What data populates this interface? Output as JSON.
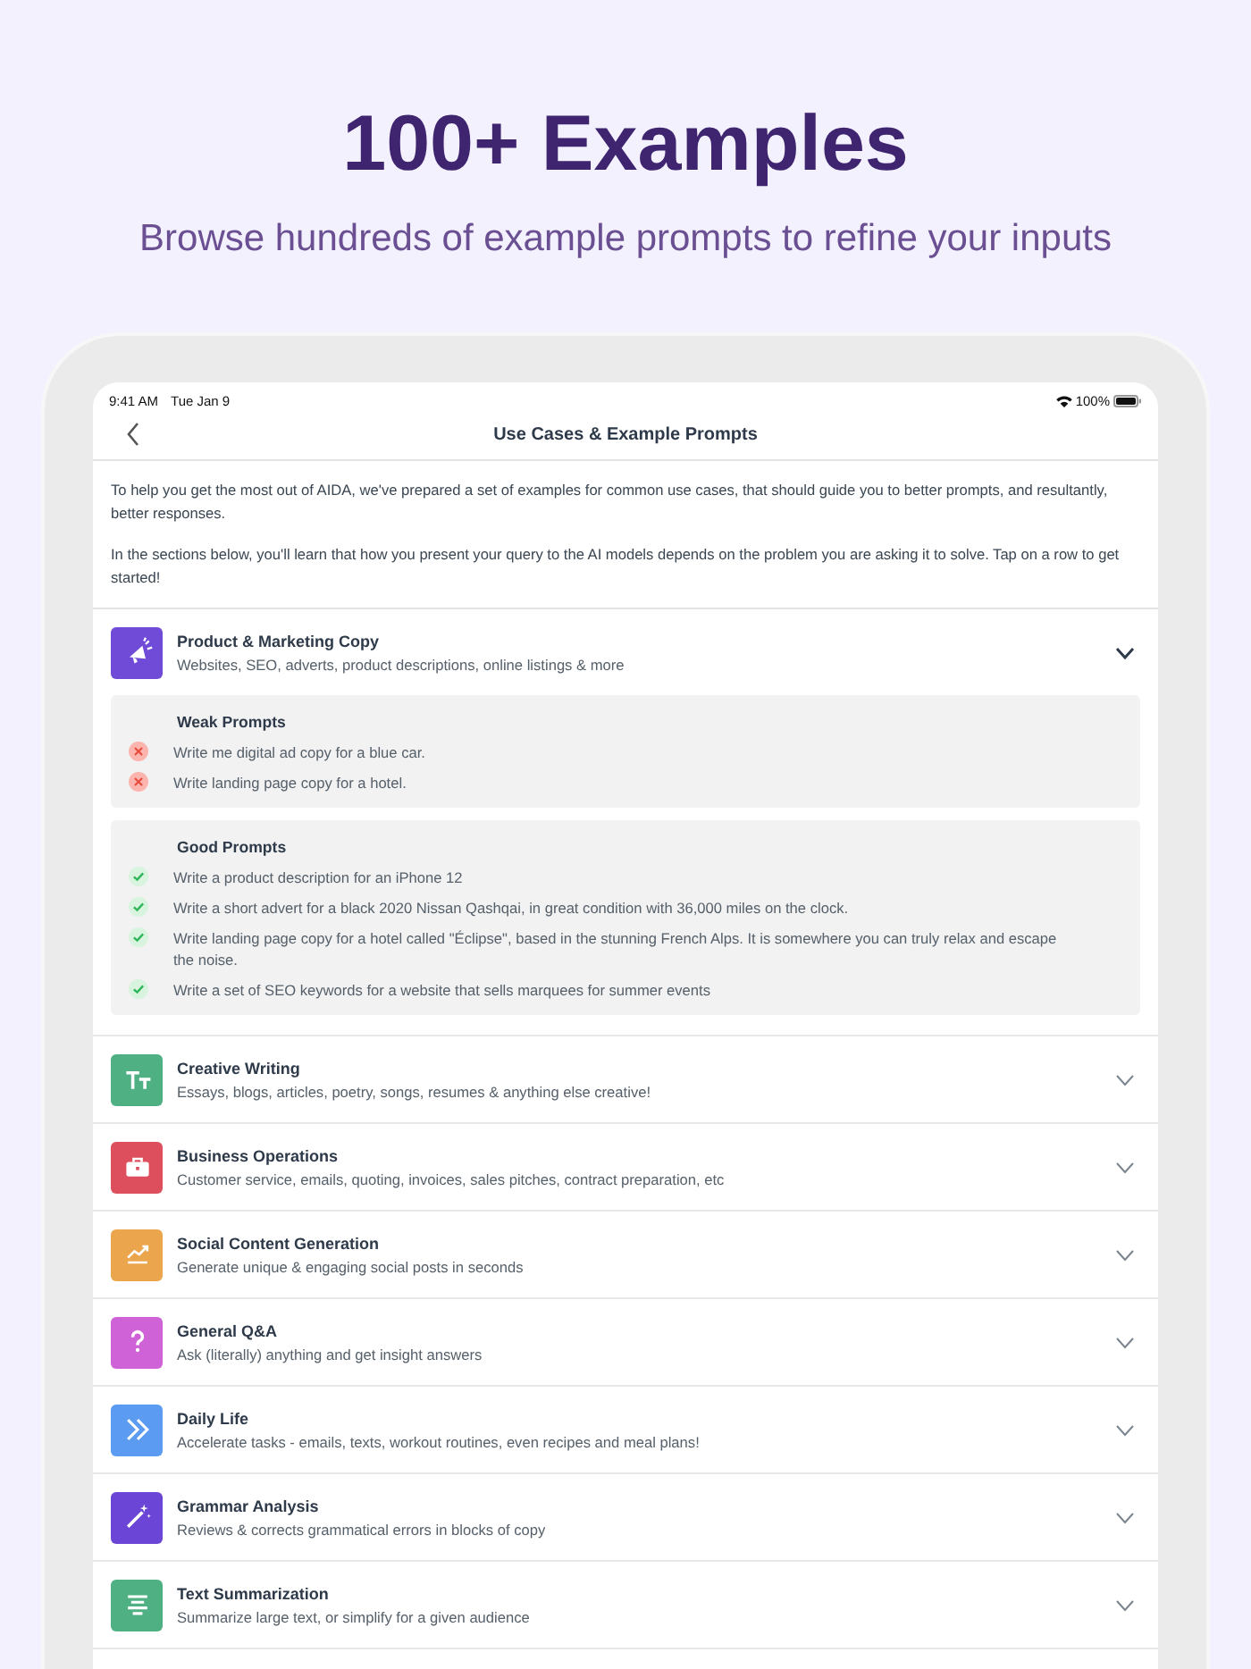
{
  "headline": "100+ Examples",
  "subheadline": "Browse hundreds of example prompts to refine your inputs",
  "status_bar": {
    "time": "9:41 AM",
    "date": "Tue Jan 9",
    "battery": "100%"
  },
  "nav": {
    "title": "Use Cases & Example Prompts"
  },
  "intro": [
    "To help you get the most out of AIDA, we've prepared a set of examples for common use cases, that should guide you to better prompts, and resultantly, better responses.",
    "In the sections below, you'll learn that how you present your query to the AI models depends on the problem you are asking it to solve. Tap on a row to get started!"
  ],
  "categories": [
    {
      "title": "Product & Marketing Copy",
      "subtitle": "Websites, SEO, adverts, product descriptions, online listings & more",
      "kind": "megaphone",
      "color": "#6f4bd8",
      "expanded": true,
      "groups": [
        {
          "kind": "weak",
          "title": "Weak Prompts",
          "items": [
            "Write me digital ad copy for a blue car.",
            "Write landing page copy for a hotel."
          ]
        },
        {
          "kind": "good",
          "title": "Good Prompts",
          "items": [
            "Write a product description for an iPhone 12",
            "Write a short advert for a black 2020 Nissan Qashqai, in great condition with 36,000 miles on the clock.",
            "Write landing page copy for a hotel called \"Éclipse\", based in the stunning French Alps. It is somewhere you can truly relax and escape the noise.",
            "Write a set of SEO keywords for a website that sells marquees for summer events"
          ]
        }
      ]
    },
    {
      "title": "Creative Writing",
      "subtitle": "Essays, blogs, articles, poetry, songs, resumes & anything else creative!",
      "kind": "text",
      "color": "#4fb183",
      "expanded": false
    },
    {
      "title": "Business Operations",
      "subtitle": "Customer service, emails, quoting, invoices, sales pitches, contract preparation, etc",
      "kind": "briefcase",
      "color": "#de4f5d",
      "expanded": false
    },
    {
      "title": "Social Content Generation",
      "subtitle": "Generate unique & engaging social posts in seconds",
      "kind": "chart",
      "color": "#eba54c",
      "expanded": false
    },
    {
      "title": "General Q&A",
      "subtitle": "Ask (literally) anything and get insight answers",
      "kind": "question",
      "color": "#cf62d6",
      "expanded": false
    },
    {
      "title": "Daily Life",
      "subtitle": "Accelerate tasks - emails, texts, workout routines, even recipes and meal plans!",
      "kind": "chevrons",
      "color": "#5b9cf2",
      "expanded": false
    },
    {
      "title": "Grammar Analysis",
      "subtitle": "Reviews & corrects grammatical errors in blocks of copy",
      "kind": "wand",
      "color": "#6a45d6",
      "expanded": false
    },
    {
      "title": "Text Summarization",
      "subtitle": "Summarize large text, or simplify for a given audience",
      "kind": "lines",
      "color": "#4fb183",
      "expanded": false
    }
  ]
}
